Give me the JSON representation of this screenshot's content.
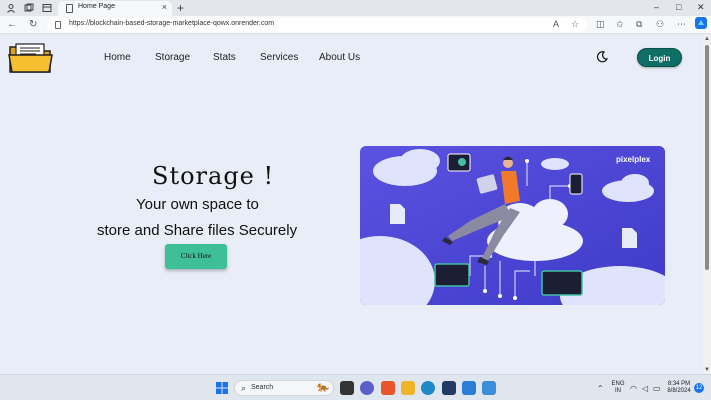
{
  "browser": {
    "tab_title": "Home Page",
    "tab_close": "×",
    "new_tab": "+",
    "url": "https://blockchain-based-storage-marketplace-qowx.onrender.com",
    "window_controls": [
      "–",
      "□",
      "✕"
    ]
  },
  "nav": {
    "links": [
      "Home",
      "Storage",
      "Stats",
      "Services",
      "About Us"
    ],
    "login_label": "Login"
  },
  "hero": {
    "title": "Storage !",
    "line1": "Your own space to",
    "line2": "store and Share files Securely",
    "cta_label": "Click Here"
  },
  "illustration": {
    "brand": "pixelplex"
  },
  "taskbar": {
    "search_label": "Search",
    "lang_line1": "ENG",
    "lang_line2": "IN",
    "time": "8:34 PM",
    "date": "8/8/2024",
    "notification_count": "12"
  },
  "colors": {
    "login_button": "#0f6e66",
    "cta_button": "#3fbf95",
    "illustration_bg": "#4a45d6",
    "page_bg": "#e8edf7"
  }
}
